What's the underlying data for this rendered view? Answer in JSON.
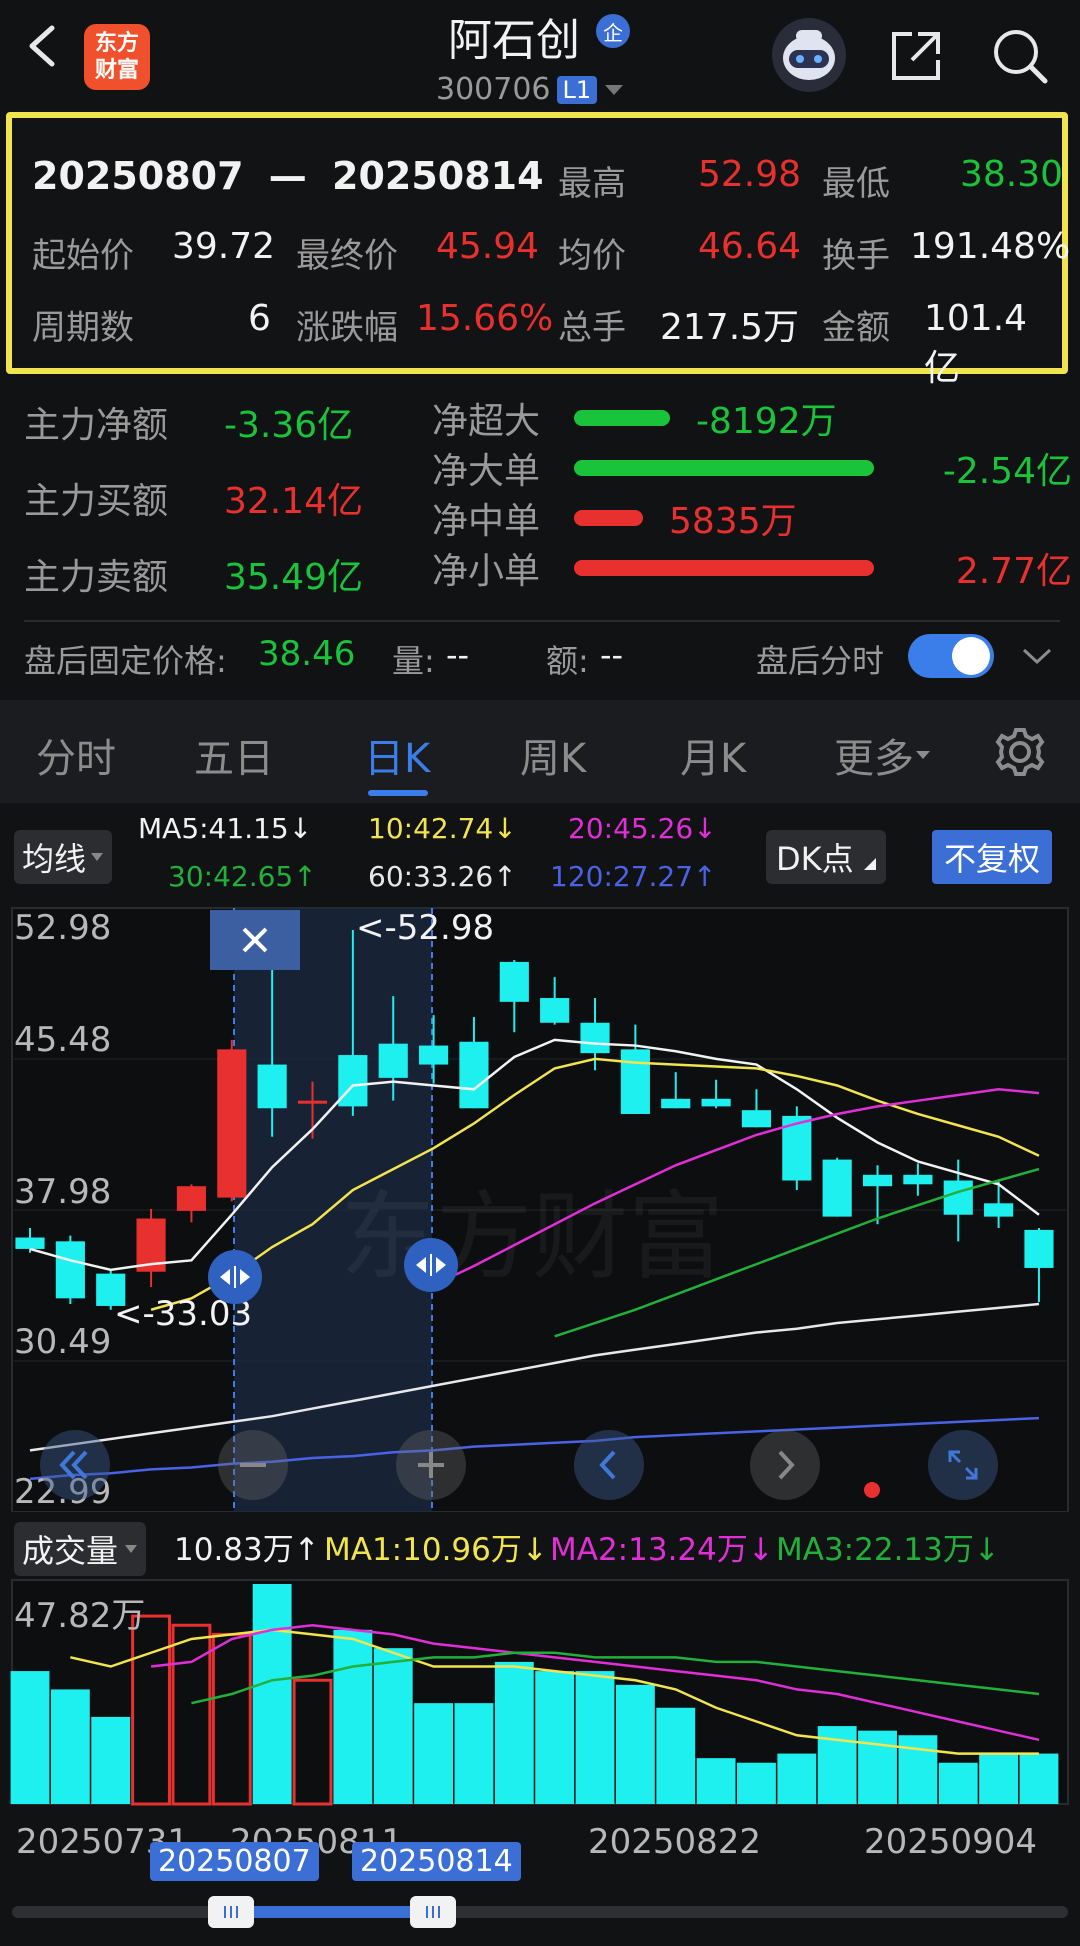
{
  "header": {
    "logo_line1": "东方",
    "logo_line2": "财富",
    "title": "阿石创",
    "badge": "企",
    "code": "300706",
    "level": "L1"
  },
  "summary": {
    "range_start": "20250807",
    "range_sep": "—",
    "range_end": "20250814",
    "high_label": "最高",
    "high": "52.98",
    "low_label": "最低",
    "low": "38.30",
    "open_label": "起始价",
    "open": "39.72",
    "close_label": "最终价",
    "close": "45.94",
    "avg_label": "均价",
    "avg": "46.64",
    "turnover_label": "换手",
    "turnover": "191.48%",
    "periods_label": "周期数",
    "periods": "6",
    "change_label": "涨跌幅",
    "change": "15.66%",
    "volume_label": "总手",
    "volume": "217.5万",
    "amount_label": "金额",
    "amount": "101.4亿"
  },
  "capital": {
    "net_label": "主力净额",
    "net": "-3.36亿",
    "buy_label": "主力买额",
    "buy": "32.14亿",
    "sell_label": "主力卖额",
    "sell": "35.49亿",
    "rows": [
      {
        "label": "净超大",
        "value": "-8192万",
        "color": "#19c43b",
        "fraction": 0.32
      },
      {
        "label": "净大单",
        "value": "-2.54亿",
        "color": "#19c43b",
        "fraction": 1.0
      },
      {
        "label": "净中单",
        "value": "5835万",
        "color": "#e8302e",
        "fraction": 0.23
      },
      {
        "label": "净小单",
        "value": "2.77亿",
        "color": "#e8302e",
        "fraction": 1.0
      }
    ]
  },
  "after_hours": {
    "label": "盘后固定价格:",
    "price": "38.46",
    "vol_label": "量:",
    "vol": "--",
    "amt_label": "额:",
    "amt": "--",
    "toggle_label": "盘后分时",
    "toggle_on": true
  },
  "tabs": [
    "分时",
    "五日",
    "日K",
    "周K",
    "月K",
    "更多"
  ],
  "active_tab": "日K",
  "ma_bar": {
    "selector": "均线",
    "ma5": "MA5:41.15↓",
    "ma10": "10:42.74↓",
    "ma20": "20:45.26↓",
    "ma30": "30:42.65↑",
    "ma60": "60:33.26↑",
    "ma120": "120:27.27↑",
    "dk": "DK点",
    "adjust": "不复权"
  },
  "volume_bar": {
    "selector": "成交量",
    "vol": "10.83万↑",
    "ma1": "MA1:10.96万↓",
    "ma2": "MA2:13.24万↓",
    "ma3": "MA3:22.13万↓"
  },
  "colors": {
    "up": "#e8302e",
    "down": "#19c43b",
    "down_candle": "#1ef0f0",
    "accent": "#3b7de9",
    "highlight": "#f2e44e"
  },
  "chart_data": {
    "type": "candlestick",
    "y_ticks": [
      "52.98",
      "45.48",
      "37.98",
      "30.49",
      "22.99"
    ],
    "ylim": [
      22.99,
      52.98
    ],
    "max_marker": "<-52.98",
    "min_marker": "<-33.03",
    "x_ticks": [
      "20250731",
      "20250811",
      "20250822",
      "20250904"
    ],
    "selection_start": "20250807",
    "selection_end": "20250814",
    "candles": [
      {
        "o": 36.8,
        "h": 37.3,
        "l": 36.0,
        "c": 36.2
      },
      {
        "o": 36.6,
        "h": 36.9,
        "l": 33.3,
        "c": 33.6
      },
      {
        "o": 34.9,
        "h": 35.1,
        "l": 33.0,
        "c": 33.2
      },
      {
        "o": 35.0,
        "h": 38.3,
        "l": 34.2,
        "c": 37.8
      },
      {
        "o": 38.2,
        "h": 39.6,
        "l": 37.6,
        "c": 39.5
      },
      {
        "o": 38.9,
        "h": 47.2,
        "l": 38.7,
        "c": 46.7
      },
      {
        "o": 45.9,
        "h": 52.0,
        "l": 42.1,
        "c": 43.6
      },
      {
        "o": 44.0,
        "h": 45.0,
        "l": 42.0,
        "c": 44.0
      },
      {
        "o": 46.4,
        "h": 52.98,
        "l": 43.2,
        "c": 43.7
      },
      {
        "o": 47.0,
        "h": 49.5,
        "l": 44.0,
        "c": 45.2
      },
      {
        "o": 46.9,
        "h": 48.5,
        "l": 44.9,
        "c": 45.9
      },
      {
        "o": 47.1,
        "h": 48.4,
        "l": 43.6,
        "c": 43.6
      },
      {
        "o": 51.3,
        "h": 51.4,
        "l": 47.6,
        "c": 49.2
      },
      {
        "o": 49.4,
        "h": 50.5,
        "l": 48.0,
        "c": 48.1
      },
      {
        "o": 48.1,
        "h": 49.4,
        "l": 45.6,
        "c": 46.5
      },
      {
        "o": 46.7,
        "h": 48.0,
        "l": 43.3,
        "c": 43.3
      },
      {
        "o": 44.1,
        "h": 45.5,
        "l": 43.6,
        "c": 43.6
      },
      {
        "o": 44.1,
        "h": 45.1,
        "l": 43.6,
        "c": 43.7
      },
      {
        "o": 43.5,
        "h": 44.6,
        "l": 42.6,
        "c": 42.6
      },
      {
        "o": 43.2,
        "h": 43.7,
        "l": 39.3,
        "c": 39.8
      },
      {
        "o": 40.9,
        "h": 41.0,
        "l": 37.9,
        "c": 37.9
      },
      {
        "o": 40.1,
        "h": 40.6,
        "l": 37.5,
        "c": 39.5
      },
      {
        "o": 40.1,
        "h": 40.7,
        "l": 39.0,
        "c": 39.6
      },
      {
        "o": 39.8,
        "h": 40.9,
        "l": 36.6,
        "c": 38.0
      },
      {
        "o": 38.6,
        "h": 39.8,
        "l": 37.3,
        "c": 37.9
      },
      {
        "o": 37.2,
        "h": 37.3,
        "l": 33.4,
        "c": 35.2
      }
    ],
    "ma5": [
      36.2,
      35.6,
      35.1,
      35.4,
      35.6,
      38.0,
      40.5,
      42.5,
      44.8,
      45.0,
      44.8,
      44.6,
      46.3,
      47.2,
      47.0,
      46.9,
      46.6,
      46.2,
      45.9,
      44.6,
      43.1,
      41.8,
      40.8,
      40.2,
      39.6,
      38.0
    ],
    "ma10": [
      null,
      null,
      null,
      33.0,
      33.6,
      34.8,
      36.3,
      37.5,
      39.3,
      40.4,
      41.5,
      42.8,
      44.3,
      45.7,
      46.2,
      46.0,
      45.9,
      45.8,
      45.7,
      45.3,
      44.8,
      44.0,
      43.3,
      42.7,
      42.1,
      41.1
    ],
    "ma20": [
      null,
      null,
      null,
      null,
      null,
      null,
      null,
      null,
      null,
      null,
      34.3,
      35.3,
      36.4,
      37.5,
      38.6,
      39.6,
      40.6,
      41.4,
      42.2,
      42.8,
      43.3,
      43.7,
      44.0,
      44.3,
      44.6,
      44.4
    ],
    "ma30": [
      null,
      null,
      null,
      null,
      null,
      null,
      null,
      null,
      null,
      null,
      null,
      null,
      null,
      31.6,
      32.3,
      33.0,
      33.8,
      34.6,
      35.4,
      36.2,
      37.0,
      37.8,
      38.5,
      39.2,
      39.8,
      40.4
    ],
    "ma60": [
      25.6,
      25.9,
      26.2,
      26.5,
      26.8,
      27.1,
      27.4,
      27.8,
      28.2,
      28.6,
      29.0,
      29.4,
      29.8,
      30.2,
      30.6,
      30.9,
      31.2,
      31.5,
      31.8,
      32.0,
      32.3,
      32.5,
      32.7,
      32.9,
      33.1,
      33.3
    ],
    "ma120": [
      24.1,
      24.3,
      24.4,
      24.6,
      24.7,
      24.9,
      25.0,
      25.2,
      25.3,
      25.5,
      25.6,
      25.8,
      25.9,
      26.0,
      26.1,
      26.3,
      26.4,
      26.5,
      26.6,
      26.7,
      26.8,
      26.9,
      27.0,
      27.1,
      27.2,
      27.3
    ]
  },
  "volume_data": {
    "top_label": "47.82万",
    "max": 48.0,
    "volumes": [
      29,
      25,
      19,
      41,
      39,
      37,
      48,
      27,
      38,
      34,
      22,
      22,
      31,
      29,
      29,
      26,
      21,
      10,
      9,
      11,
      17,
      16,
      15,
      9,
      11,
      11
    ],
    "ma1": [
      null,
      32,
      30,
      33,
      36,
      37,
      38,
      37,
      36,
      33,
      30,
      30,
      30,
      29,
      28,
      27,
      25,
      21,
      18,
      15,
      14,
      13,
      12,
      11,
      11,
      11
    ],
    "ma2": [
      null,
      null,
      null,
      30,
      31,
      36,
      38,
      39,
      38,
      37,
      35,
      34,
      33,
      32,
      31,
      30,
      29,
      28,
      27,
      25,
      24,
      22,
      20,
      18,
      16,
      14
    ],
    "ma3": [
      null,
      null,
      null,
      null,
      22,
      24,
      27,
      28,
      30,
      31,
      32,
      32,
      33,
      33,
      32,
      32,
      32,
      31,
      31,
      30,
      29,
      28,
      27,
      26,
      25,
      24
    ]
  }
}
